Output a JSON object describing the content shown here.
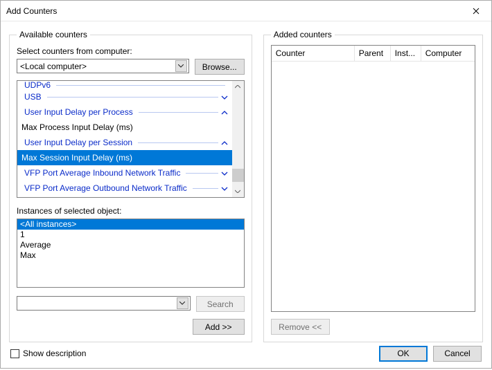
{
  "window": {
    "title": "Add Counters"
  },
  "available": {
    "legend": "Available counters",
    "computer_label": "Select counters from computer:",
    "computer_value": "<Local computer>",
    "browse_label": "Browse...",
    "counters": {
      "partial_top": "UDPv6",
      "usb": "USB",
      "uid_process": "User Input Delay per Process",
      "uid_process_child": "Max Process Input Delay (ms)",
      "uid_session": "User Input Delay per Session",
      "uid_session_child": "Max Session Input Delay (ms)",
      "vfp_in": "VFP Port Average Inbound Network Traffic",
      "vfp_out": "VFP Port Average Outbound Network Traffic"
    },
    "instances_label": "Instances of selected object:",
    "instances": [
      "<All instances>",
      "1",
      "Average",
      "Max"
    ],
    "search_label": "Search",
    "add_label": "Add >>"
  },
  "added": {
    "legend": "Added counters",
    "headers": {
      "counter": "Counter",
      "parent": "Parent",
      "inst": "Inst...",
      "computer": "Computer"
    },
    "remove_label": "Remove <<"
  },
  "bottom": {
    "show_description": "Show description",
    "ok_label": "OK",
    "cancel_label": "Cancel"
  }
}
